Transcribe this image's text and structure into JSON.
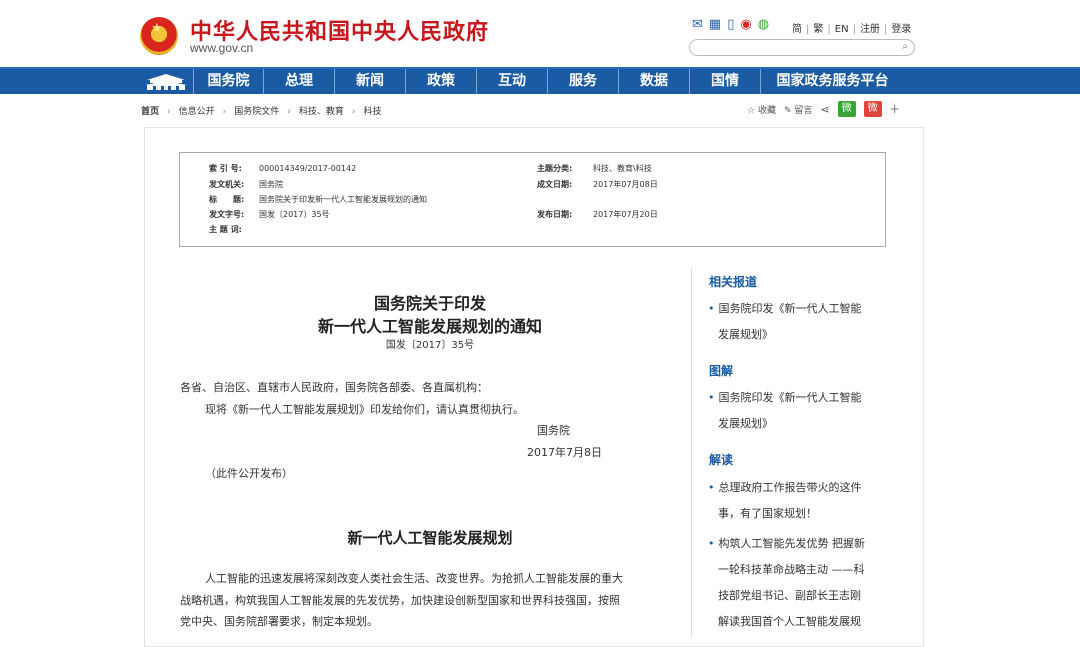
{
  "header": {
    "site_name": "中华人民共和国中央人民政府",
    "site_url": "www.gov.cn",
    "top_links": [
      "简",
      "繁",
      "EN",
      "注册",
      "登录"
    ]
  },
  "nav": {
    "items": [
      "国务院",
      "总理",
      "新闻",
      "政策",
      "互动",
      "服务",
      "数据",
      "国情",
      "国家政务服务平台"
    ]
  },
  "breadcrumb": {
    "items": [
      "首页",
      "信息公开",
      "国务院文件",
      "科技、教育",
      "科技"
    ]
  },
  "tools": {
    "favorite": "收藏",
    "comment": "留言",
    "wechat": "微",
    "weibo": "微",
    "plus": "+"
  },
  "meta": {
    "index_label": "索 引 号:",
    "index_value": "000014349/2017-00142",
    "category_label": "主题分类:",
    "category_value": "科技、教育\\科技",
    "issuer_label": "发文机关:",
    "issuer_value": "国务院",
    "date_label": "成文日期:",
    "date_value": "2017年07月08日",
    "title_label": "标　　题:",
    "title_value": "国务院关于印发新一代人工智能发展规划的通知",
    "docno_label": "发文字号:",
    "docno_value": "国发〔2017〕35号",
    "pubdate_label": "发布日期:",
    "pubdate_value": "2017年07月20日",
    "keywords_label": "主 题 词:"
  },
  "article": {
    "title_line1": "国务院关于印发",
    "title_line2": "新一代人工智能发展规划的通知",
    "doc_number": "国发〔2017〕35号",
    "recipients": "各省、自治区、直辖市人民政府，国务院各部委、各直属机构：",
    "body": "现将《新一代人工智能发展规划》印发给你们，请认真贯彻执行。",
    "signature": "国务院",
    "sign_date": "2017年7月8日",
    "note": "（此件公开发布）",
    "section_title": "新一代人工智能发展规划",
    "para_line1": "人工智能的迅速发展将深刻改变人类社会生活、改变世界。为抢抓人工智能发展的重大",
    "para_line2": "战略机遇，构筑我国人工智能发展的先发优势，加快建设创新型国家和世界科技强国，按照",
    "para_line3": "党中央、国务院部署要求，制定本规划。"
  },
  "sidebar": {
    "related_title": "相关报道",
    "related_line1": "国务院印发《新一代人工智能",
    "related_line2": "发展规划》",
    "graphic_title": "图解",
    "graphic_line1": "国务院印发《新一代人工智能",
    "graphic_line2": "发展规划》",
    "interpret_title": "解读",
    "interp1_line1": "总理政府工作报告带火的这件",
    "interp1_line2": "事，有了国家规划！",
    "interp2_line1": "构筑人工智能先发优势 把握新",
    "interp2_line2": "一轮科技革命战略主动 ——科",
    "interp2_line3": "技部党组书记、副部长王志刚",
    "interp2_line4": "解读我国首个人工智能发展规"
  },
  "colors": {
    "brand_red": "#c8161d",
    "nav_blue": "#1a5ba3",
    "link_blue": "#1a5ba3"
  }
}
